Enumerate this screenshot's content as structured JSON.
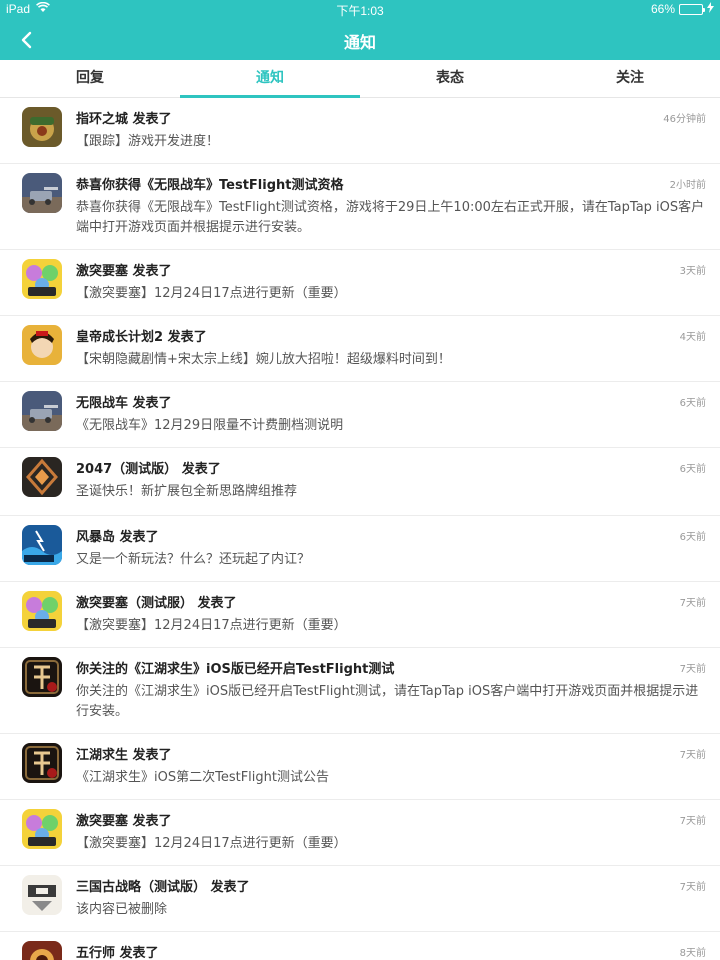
{
  "status_bar": {
    "device": "iPad",
    "time": "下午1:03",
    "battery_pct": "66%",
    "battery_level": 0.66
  },
  "nav": {
    "title": "通知"
  },
  "tabs": [
    {
      "label": "回复",
      "active": false
    },
    {
      "label": "通知",
      "active": true
    },
    {
      "label": "表态",
      "active": false
    },
    {
      "label": "关注",
      "active": false
    }
  ],
  "notifications": [
    {
      "title": "指环之城 发表了",
      "time": "46分钟前",
      "body": "【跟踪】游戏开发进度！",
      "icon": "ring-city-game-icon"
    },
    {
      "title": "恭喜你获得《无限战车》TestFlight测试资格",
      "time": "2小时前",
      "body": "恭喜你获得《无限战车》TestFlight测试资格，游戏将于29日上午10:00左右正式开服，请在TapTap iOS客户端中打开游戏页面并根据提示进行安装。",
      "icon": "infinite-tank-game-icon"
    },
    {
      "title": "激突要塞 发表了",
      "time": "3天前",
      "body": "【激突要塞】12月24日17点进行更新（重要）",
      "icon": "gekitotsu-fortress-game-icon"
    },
    {
      "title": "皇帝成长计划2 发表了",
      "time": "4天前",
      "body": "【宋朝隐藏剧情+宋太宗上线】婉儿放大招啦！超级爆料时间到！",
      "icon": "emperor-growth-game-icon"
    },
    {
      "title": "无限战车 发表了",
      "time": "6天前",
      "body": "《无限战车》12月29日限量不计费删档测说明",
      "icon": "infinite-tank-game-icon"
    },
    {
      "title": "2047（测试版） 发表了",
      "time": "6天前",
      "body": "圣诞快乐！新扩展包全新思路牌组推荐",
      "icon": "game-2047-icon"
    },
    {
      "title": "风暴岛 发表了",
      "time": "6天前",
      "body": "又是一个新玩法？什么？还玩起了内讧？",
      "icon": "storm-island-game-icon"
    },
    {
      "title": "激突要塞（测试服） 发表了",
      "time": "7天前",
      "body": "【激突要塞】12月24日17点进行更新（重要）",
      "icon": "gekitotsu-fortress-game-icon"
    },
    {
      "title": "你关注的《江湖求生》iOS版已经开启TestFlight测试",
      "time": "7天前",
      "body": "你关注的《江湖求生》iOS版已经开启TestFlight测试，请在TapTap iOS客户端中打开游戏页面并根据提示进行安装。",
      "icon": "jianghu-survival-game-icon"
    },
    {
      "title": "江湖求生 发表了",
      "time": "7天前",
      "body": "《江湖求生》iOS第二次TestFlight测试公告",
      "icon": "jianghu-survival-game-icon"
    },
    {
      "title": "激突要塞 发表了",
      "time": "7天前",
      "body": "【激突要塞】12月24日17点进行更新（重要）",
      "icon": "gekitotsu-fortress-game-icon"
    },
    {
      "title": "三国古战略（测试版） 发表了",
      "time": "7天前",
      "body": "该内容已被删除",
      "icon": "three-kingdoms-game-icon"
    },
    {
      "title": "五行师 发表了",
      "time": "8天前",
      "body": "",
      "icon": "wuxing-master-game-icon"
    }
  ],
  "colors": {
    "accent": "#2ec4c0"
  }
}
